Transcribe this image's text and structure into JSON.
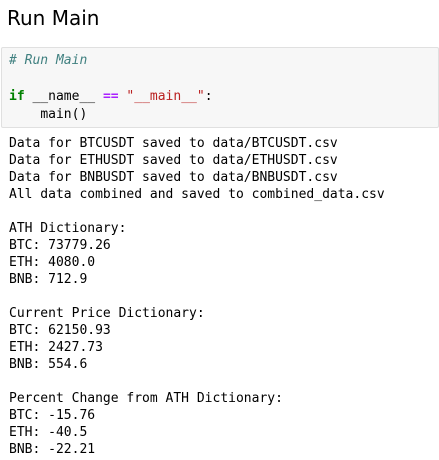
{
  "heading": "Run Main",
  "code": {
    "comment": "# Run Main",
    "if_keyword": "if",
    "name_var": "__name__",
    "eq_op": "==",
    "main_string": "\"__main__\"",
    "colon": ":",
    "indent": "    ",
    "call": "main()"
  },
  "output_lines": [
    "Data for BTCUSDT saved to data/BTCUSDT.csv",
    "Data for ETHUSDT saved to data/ETHUSDT.csv",
    "Data for BNBUSDT saved to data/BNBUSDT.csv",
    "All data combined and saved to combined_data.csv",
    "",
    "ATH Dictionary:",
    "BTC: 73779.26",
    "ETH: 4080.0",
    "BNB: 712.9",
    "",
    "Current Price Dictionary:",
    "BTC: 62150.93",
    "ETH: 2427.73",
    "BNB: 554.6",
    "",
    "Percent Change from ATH Dictionary:",
    "BTC: -15.76",
    "ETH: -40.5",
    "BNB: -22.21"
  ]
}
